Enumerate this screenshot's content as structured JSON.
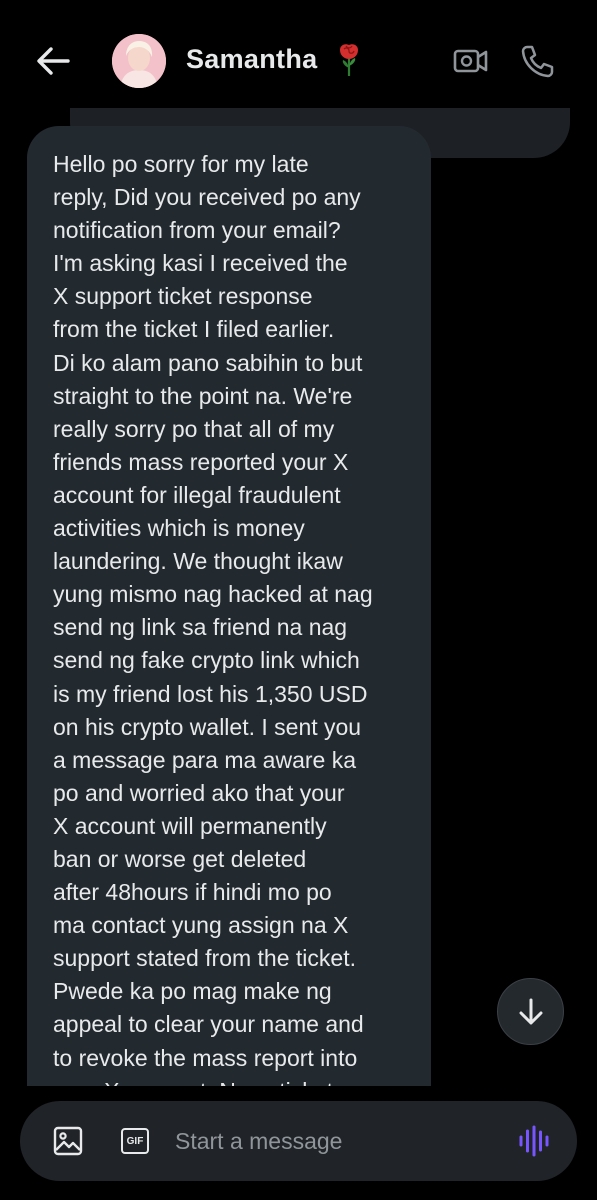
{
  "header": {
    "contact_name": "Samantha",
    "back_icon": "arrow-left-icon",
    "name_emoji": "rose-icon",
    "video_icon": "video-camera-icon",
    "call_icon": "phone-icon"
  },
  "message": {
    "lines": [
      "Hello po sorry for my late",
      "reply, Did you received po any",
      "notification from your email?",
      "I'm asking kasi I received the",
      "X support ticket response",
      "from the ticket I filed earlier.",
      "Di ko alam pano sabihin to but",
      "straight to the point na. We're",
      "really sorry po that all of my",
      "friends mass reported your X",
      "account for illegal fraudulent",
      "activities which is money",
      "laundering. We thought ikaw",
      "yung mismo nag hacked at nag",
      "send ng link sa friend na nag",
      "send ng fake crypto link which",
      "is my friend lost his 1,350 USD",
      "on his crypto wallet. I sent you",
      "a message para ma aware ka",
      "po and worried ako that your",
      "X account will permanently",
      "ban or worse get deleted",
      "after 48hours if hindi mo po",
      "ma contact yung assign na X",
      "support stated from the ticket.",
      "Pwede ka po mag make ng",
      "appeal to clear your name and",
      "to revoke the mass report into",
      "your X account. Nasa ticket"
    ]
  },
  "composer": {
    "placeholder": "Start a message",
    "gif_label": "GIF",
    "image_icon": "image-icon",
    "voice_icon": "voice-waveform-icon"
  },
  "scroll_button": {
    "icon": "arrow-down-icon"
  },
  "colors": {
    "background": "#000000",
    "bubble": "#222a30",
    "text": "#e7e9ea",
    "placeholder": "#8f959a",
    "accent_voice": "#7856ff"
  }
}
